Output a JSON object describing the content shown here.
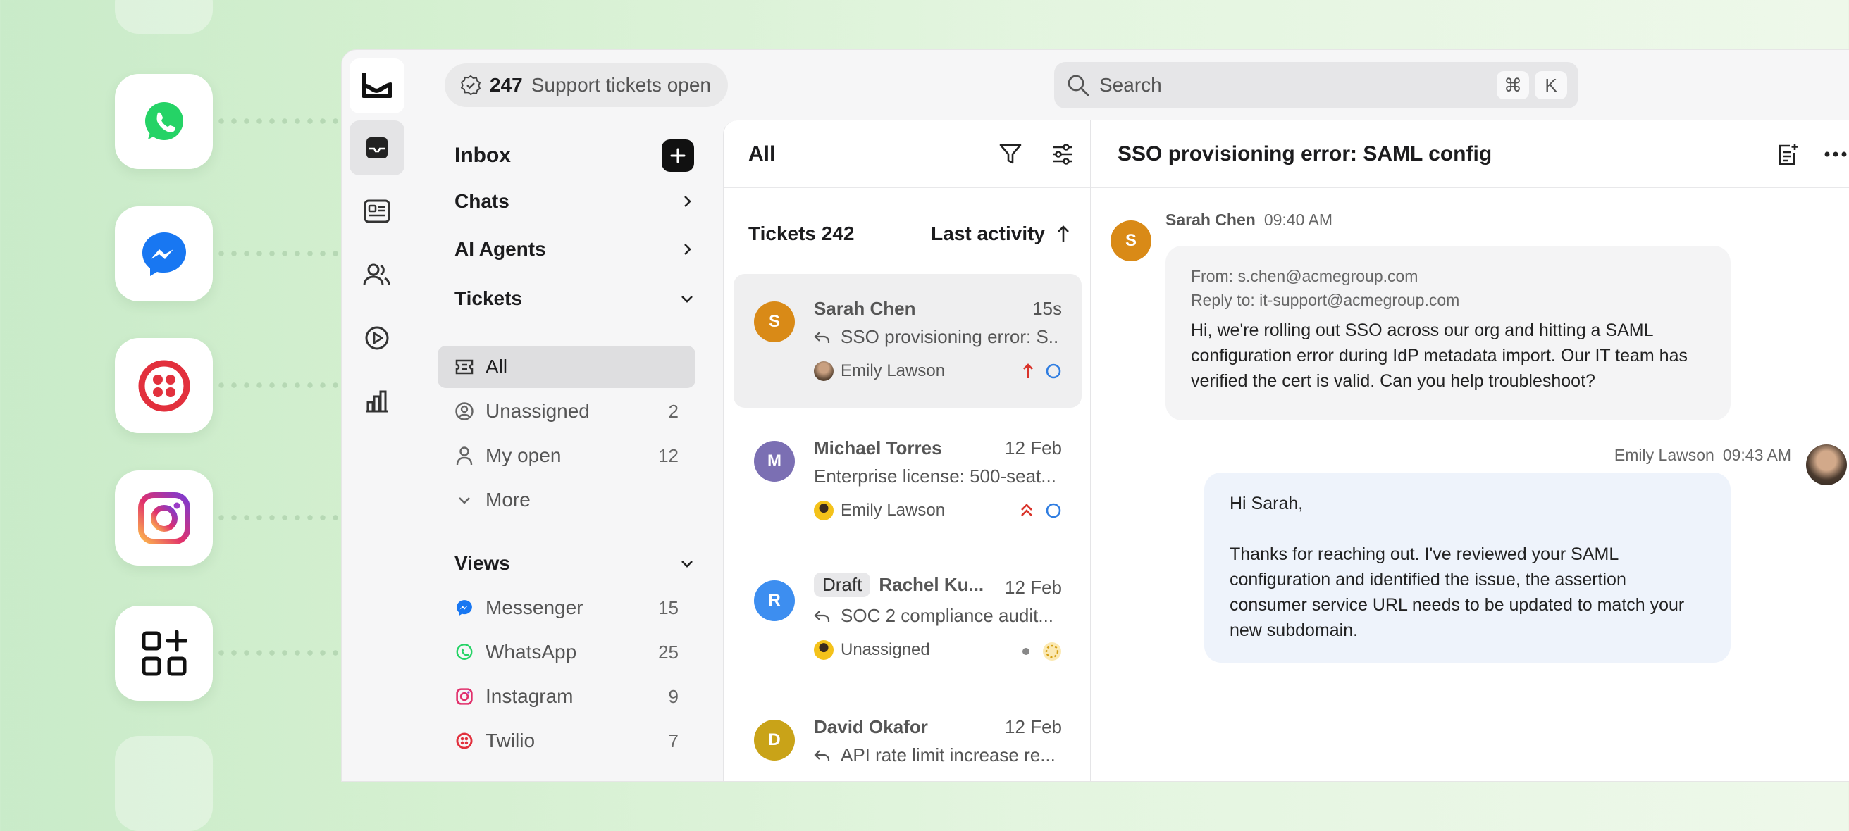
{
  "channels": [
    "whatsapp-icon",
    "messenger-icon",
    "twilio-icon",
    "instagram-icon",
    "integrations-icon"
  ],
  "colors": {
    "accent": "#111111",
    "whatsapp": "#25D366",
    "messenger": "#1877F2",
    "twilio": "#E2303D",
    "instagram": "#E1306C",
    "urgent": "#d9342b",
    "bubble_out": "#eef3fb",
    "bubble_in": "#f4f4f5"
  },
  "topbar": {
    "open_count": "247",
    "open_label": "Support tickets open",
    "search_placeholder": "Search",
    "shortcut_mod": "⌘",
    "shortcut_key": "K"
  },
  "sidebar": {
    "title": "Inbox",
    "sections": {
      "chats": "Chats",
      "ai_agents": "AI Agents",
      "tickets": "Tickets",
      "views": "Views"
    },
    "ticket_items": [
      {
        "label": "All",
        "count": ""
      },
      {
        "label": "Unassigned",
        "count": "2"
      },
      {
        "label": "My open",
        "count": "12"
      },
      {
        "label": "More",
        "count": ""
      }
    ],
    "view_items": [
      {
        "label": "Messenger",
        "count": "15"
      },
      {
        "label": "WhatsApp",
        "count": "25"
      },
      {
        "label": "Instagram",
        "count": "9"
      },
      {
        "label": "Twilio",
        "count": "7"
      }
    ]
  },
  "list": {
    "title": "All",
    "tickets_label": "Tickets 242",
    "sort_label": "Last activity",
    "tickets": [
      {
        "initial": "S",
        "name": "Sarah Chen",
        "time": "15s",
        "preview": "SSO provisioning error: S...",
        "assignee": "Emily Lawson",
        "color": "#d98a17"
      },
      {
        "initial": "M",
        "name": "Michael Torres",
        "time": "12 Feb",
        "preview": "Enterprise license: 500-seat...",
        "assignee": "Emily Lawson",
        "color": "#7b6fb3"
      },
      {
        "initial": "R",
        "name": "Rachel Ku...",
        "time": "12 Feb",
        "preview": "SOC 2 compliance audit...",
        "assignee": "Unassigned",
        "draft": "Draft",
        "color": "#3d8ef0"
      },
      {
        "initial": "D",
        "name": "David Okafor",
        "time": "12 Feb",
        "preview": "API rate limit increase re...",
        "assignee": "",
        "color": "#c9a318"
      }
    ]
  },
  "conversation": {
    "title": "SSO provisioning error: SAML config",
    "inbound": {
      "initial": "S",
      "sender": "Sarah Chen",
      "time": "09:40 AM",
      "from": "From: s.chen@acmegroup.com",
      "reply_to": "Reply to: it-support@acmegroup.com",
      "body": "Hi, we're rolling out SSO across our org and hitting a SAML configuration error during IdP metadata import. Our IT team has verified the cert is valid. Can you help troubleshoot?"
    },
    "outbound": {
      "sender": "Emily Lawson",
      "time": "09:43 AM",
      "greeting": "Hi Sarah,",
      "body": "Thanks for reaching out. I've reviewed your SAML configuration and identified the issue, the assertion consumer service URL needs to be updated to match your new subdomain."
    }
  }
}
